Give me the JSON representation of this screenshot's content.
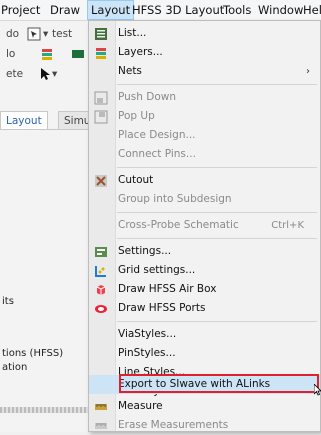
{
  "menubar": [
    {
      "label": "Project",
      "active": false
    },
    {
      "label": "Draw",
      "active": false
    },
    {
      "label": "Layout",
      "active": true
    },
    {
      "label": "HFSS 3D Layout",
      "active": false
    },
    {
      "label": "Tools",
      "active": false
    },
    {
      "label": "Window",
      "active": false
    },
    {
      "label": "Hel",
      "active": false
    }
  ],
  "background": {
    "toolbar_rows": [
      "do",
      "lo",
      "ete"
    ],
    "design_name": "test",
    "tabs": [
      "Layout",
      "Simu"
    ],
    "side_texts": [
      "its",
      "tions (HFSS)",
      "ation"
    ]
  },
  "menu": {
    "items": [
      {
        "label": "List...",
        "icon": "list-icon",
        "disabled": false
      },
      {
        "label": "Layers...",
        "icon": "layers-icon",
        "disabled": false
      },
      {
        "label": "Nets",
        "icon": "",
        "disabled": false,
        "submenu": true
      },
      {
        "label": "Push Down",
        "icon": "push-down-icon",
        "disabled": true
      },
      {
        "label": "Pop Up",
        "icon": "pop-up-icon",
        "disabled": true
      },
      {
        "label": "Place Design...",
        "icon": "",
        "disabled": true
      },
      {
        "label": "Connect Pins...",
        "icon": "",
        "disabled": true
      },
      {
        "label": "Cutout",
        "icon": "cutout-icon",
        "disabled": false
      },
      {
        "label": "Group into Subdesign",
        "icon": "",
        "disabled": true
      },
      {
        "label": "Cross-Probe Schematic",
        "icon": "",
        "disabled": true,
        "shortcut": "Ctrl+K"
      },
      {
        "label": "Settings...",
        "icon": "settings-icon",
        "disabled": false
      },
      {
        "label": "Grid settings...",
        "icon": "grid-icon",
        "disabled": false
      },
      {
        "label": "Draw HFSS Air Box",
        "icon": "air-box-icon",
        "disabled": false
      },
      {
        "label": "Draw HFSS Ports",
        "icon": "ports-icon",
        "disabled": false
      },
      {
        "label": "ViaStyles...",
        "icon": "",
        "disabled": false
      },
      {
        "label": "PinStyles...",
        "icon": "",
        "disabled": false
      },
      {
        "label": "Line Styles...",
        "icon": "",
        "disabled": false
      },
      {
        "label": "Text Styles...",
        "icon": "",
        "disabled": false
      },
      {
        "label": "Export to SIwave with ALinks",
        "icon": "",
        "disabled": false,
        "highlighted": true
      },
      {
        "label": "Measure",
        "icon": "measure-icon",
        "disabled": false
      },
      {
        "label": "Erase Measurements",
        "icon": "erase-icon",
        "disabled": true
      }
    ]
  },
  "colors": {
    "highlight": "#cde3f6",
    "red_box": "#e0202a",
    "active_tab": "#2a64b2"
  }
}
